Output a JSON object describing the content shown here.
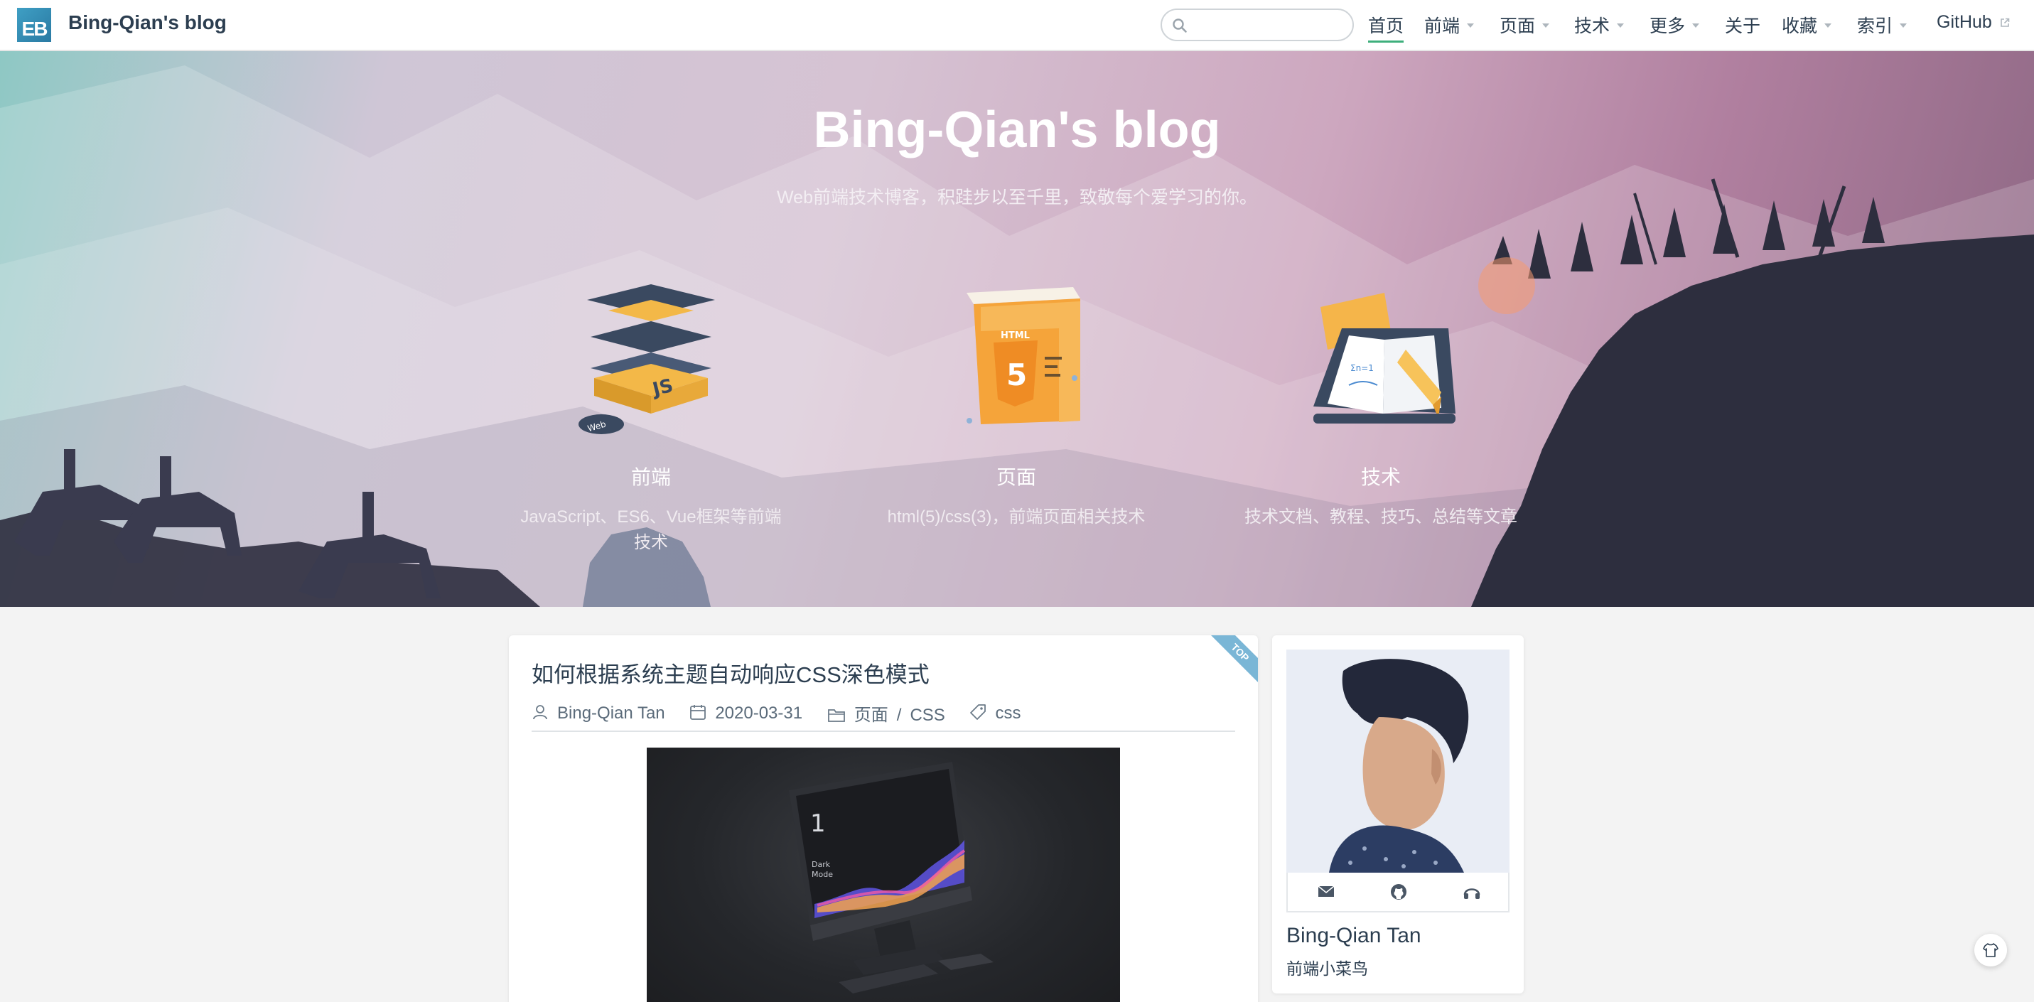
{
  "navbar": {
    "logo_text": "EB",
    "site_name": "Bing-Qian's blog",
    "search_placeholder": "",
    "items": [
      {
        "label": "首页",
        "dropdown": false,
        "active": true
      },
      {
        "label": "前端",
        "dropdown": true
      },
      {
        "label": "页面",
        "dropdown": true
      },
      {
        "label": "技术",
        "dropdown": true
      },
      {
        "label": "更多",
        "dropdown": true
      },
      {
        "label": "关于",
        "dropdown": false
      },
      {
        "label": "收藏",
        "dropdown": true
      },
      {
        "label": "索引",
        "dropdown": true
      },
      {
        "label": "GitHub",
        "dropdown": false,
        "external": true
      }
    ]
  },
  "hero": {
    "title": "Bing-Qian's blog",
    "description": "Web前端技术博客，积跬步以至千里，致敬每个爱学习的你。",
    "features": [
      {
        "title": "前端",
        "description": "JavaScript、ES6、Vue框架等前端技术",
        "icon": "js-layers-icon"
      },
      {
        "title": "页面",
        "description": "html(5)/css(3)，前端页面相关技术",
        "icon": "html5-icon"
      },
      {
        "title": "技术",
        "description": "技术文档、教程、技巧、总结等文章",
        "icon": "book-pencil-icon"
      }
    ]
  },
  "post": {
    "badge": "TOP",
    "title": "如何根据系统主题自动响应CSS深色模式",
    "author": "Bing-Qian Tan",
    "date": "2020-03-31",
    "category_parent": "页面",
    "category_sep": "/",
    "category_child": "CSS",
    "tag": "css",
    "image": {
      "screen_number": "1",
      "screen_label_1": "Dark",
      "screen_label_2": "Mode"
    }
  },
  "profile": {
    "name": "Bing-Qian Tan",
    "description": "前端小菜鸟",
    "social": [
      "email-icon",
      "github-icon",
      "headphones-icon"
    ]
  },
  "colors": {
    "accent": "#3eaf7c",
    "nav_text": "#2c3e50",
    "page_bg": "#f3f3f3"
  }
}
